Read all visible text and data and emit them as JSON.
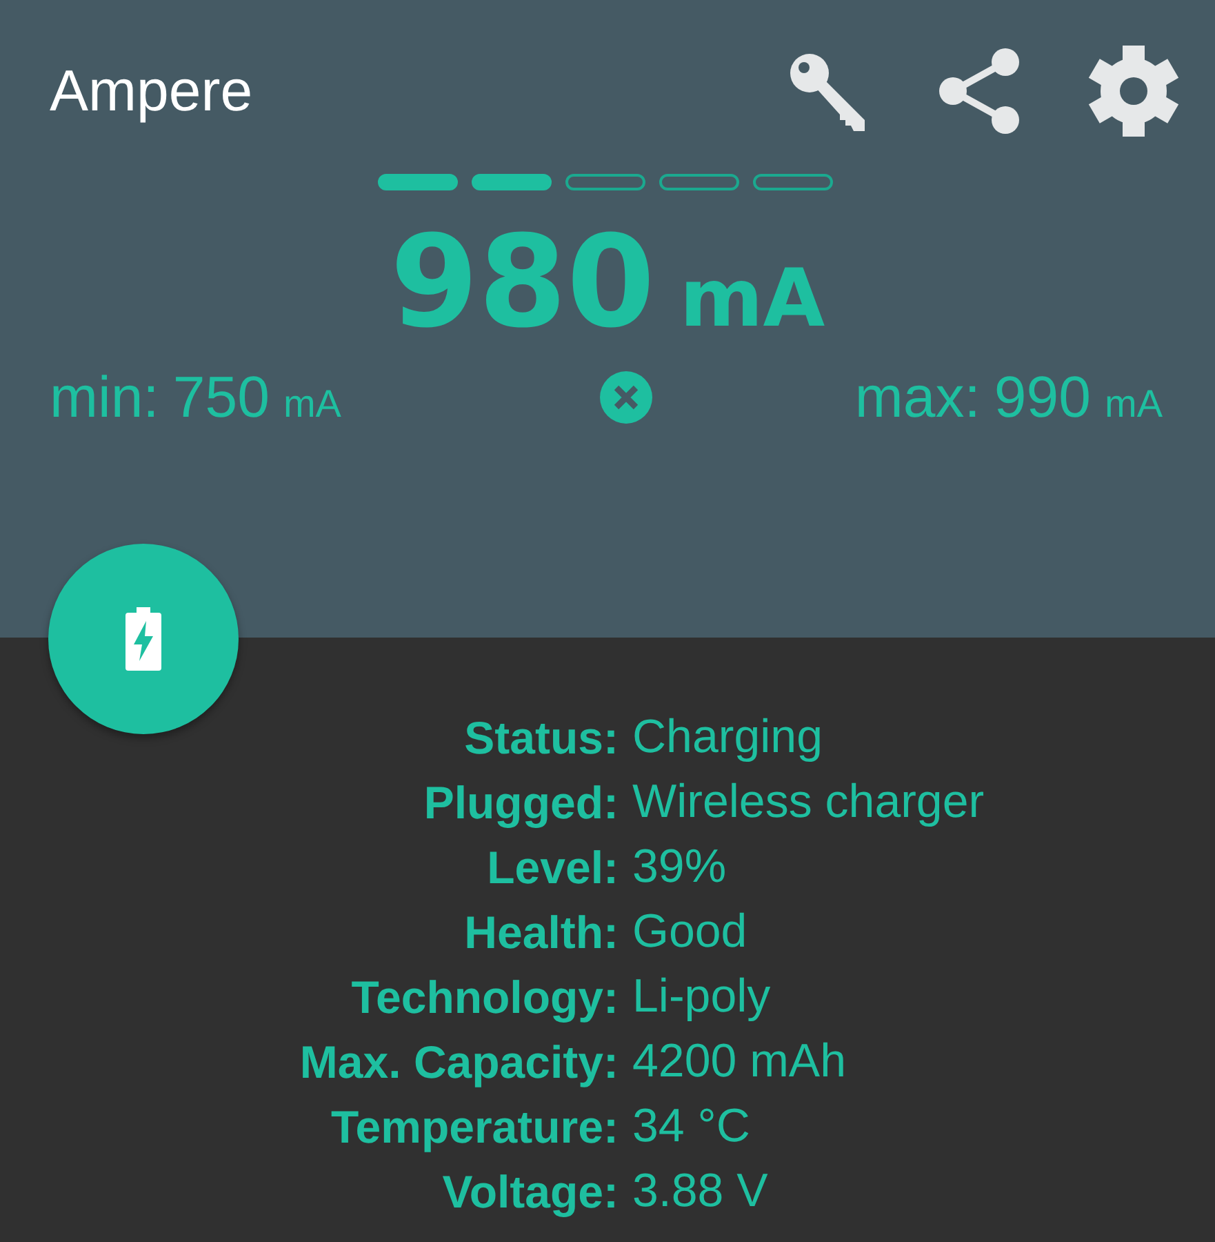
{
  "app_bar": {
    "title": "Ampere"
  },
  "segments": [
    {
      "filled": true
    },
    {
      "filled": true
    },
    {
      "filled": false
    },
    {
      "filled": false
    },
    {
      "filled": false
    }
  ],
  "reading": {
    "value": "980",
    "unit": "mA"
  },
  "min": {
    "label": "min:",
    "value": "750",
    "unit": "mA"
  },
  "max": {
    "label": "max:",
    "value": "990",
    "unit": "mA"
  },
  "info": [
    {
      "label": "Status:",
      "value": "Charging"
    },
    {
      "label": "Plugged:",
      "value": "Wireless charger"
    },
    {
      "label": "Level:",
      "value": "39%"
    },
    {
      "label": "Health:",
      "value": "Good"
    },
    {
      "label": "Technology:",
      "value": "Li-poly"
    },
    {
      "label": "Max. Capacity:",
      "value": "4200 mAh"
    },
    {
      "label": "Temperature:",
      "value": "34 °C"
    },
    {
      "label": "Voltage:",
      "value": "3.88 V"
    }
  ]
}
